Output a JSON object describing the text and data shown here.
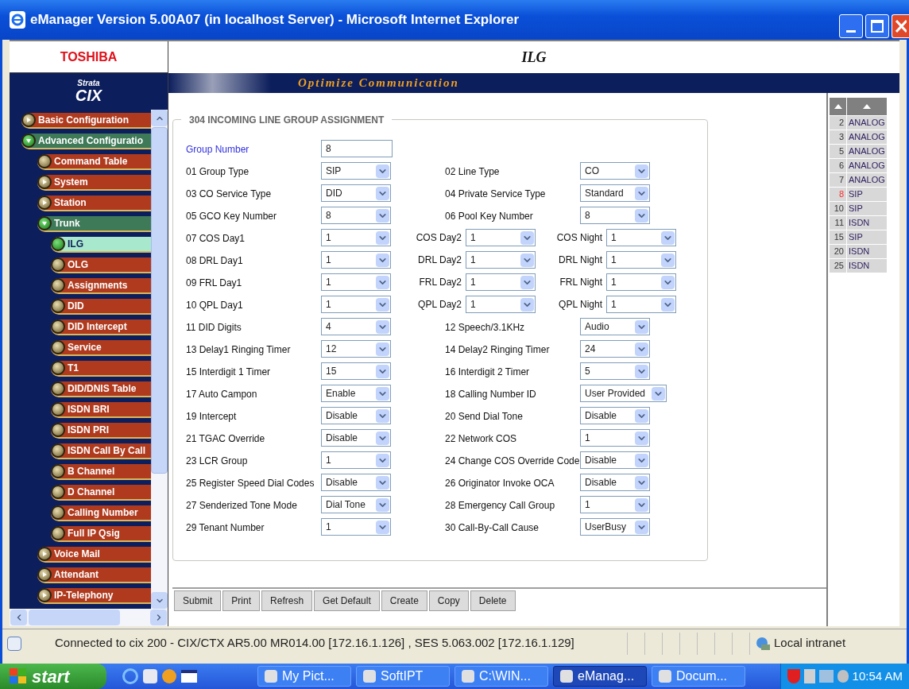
{
  "window": {
    "title": "eManager Version 5.00A07 (in localhost Server) - Microsoft Internet Explorer"
  },
  "header": {
    "brand": "TOSHIBA",
    "page_title": "ILG",
    "logo_top": "Strata",
    "logo_main": "CIX",
    "slogan": "Optimize Communication"
  },
  "nav": [
    {
      "label": "Basic Configuration",
      "expanded": false,
      "selected": false
    },
    {
      "label": "Advanced Configuratio",
      "expanded": true,
      "selected": false,
      "children": [
        {
          "label": "Command Table",
          "selected": false
        },
        {
          "label": "System",
          "expanded": false,
          "selected": false
        },
        {
          "label": "Station",
          "expanded": false,
          "selected": false
        },
        {
          "label": "Trunk",
          "expanded": true,
          "selected": false,
          "children": [
            {
              "label": "ILG",
              "selected": true
            },
            {
              "label": "OLG",
              "selected": false
            },
            {
              "label": "Assignments",
              "selected": false
            },
            {
              "label": "DID",
              "selected": false
            },
            {
              "label": "DID Intercept",
              "selected": false
            },
            {
              "label": "Service",
              "selected": false
            },
            {
              "label": "T1",
              "selected": false
            },
            {
              "label": "DID/DNIS Table",
              "selected": false
            },
            {
              "label": "ISDN BRI",
              "selected": false
            },
            {
              "label": "ISDN PRI",
              "selected": false
            },
            {
              "label": "ISDN Call By Call",
              "selected": false
            },
            {
              "label": "B Channel",
              "selected": false
            },
            {
              "label": "D Channel",
              "selected": false
            },
            {
              "label": "Calling Number",
              "selected": false
            },
            {
              "label": "Full IP Qsig",
              "selected": false
            }
          ]
        },
        {
          "label": "Voice Mail",
          "expanded": false,
          "selected": false
        },
        {
          "label": "Attendant",
          "expanded": false,
          "selected": false
        },
        {
          "label": "IP-Telephony",
          "expanded": false,
          "selected": false
        }
      ]
    }
  ],
  "form": {
    "title": "304 INCOMING LINE GROUP ASSIGNMENT",
    "group_number": {
      "label": "Group Number",
      "value": "8"
    },
    "rows": [
      [
        {
          "label": "01 Group Type",
          "value": "SIP"
        },
        {
          "label": "02 Line Type",
          "value": "CO"
        }
      ],
      [
        {
          "label": "03 CO Service Type",
          "value": "DID"
        },
        {
          "label": "04 Private Service Type",
          "value": "Standard"
        }
      ],
      [
        {
          "label": "05 GCO Key Number",
          "value": "8"
        },
        {
          "label": "06 Pool Key Number",
          "value": "8"
        }
      ],
      [
        {
          "label": "07 COS Day1",
          "value": "1"
        },
        {
          "label": "COS Day2",
          "value": "1"
        },
        {
          "label": "COS Night",
          "value": "1"
        }
      ],
      [
        {
          "label": "08 DRL Day1",
          "value": "1"
        },
        {
          "label": "DRL Day2",
          "value": "1"
        },
        {
          "label": "DRL Night",
          "value": "1"
        }
      ],
      [
        {
          "label": "09 FRL Day1",
          "value": "1"
        },
        {
          "label": "FRL Day2",
          "value": "1"
        },
        {
          "label": "FRL Night",
          "value": "1"
        }
      ],
      [
        {
          "label": "10 QPL Day1",
          "value": "1"
        },
        {
          "label": "QPL Day2",
          "value": "1"
        },
        {
          "label": "QPL Night",
          "value": "1"
        }
      ],
      [
        {
          "label": "11 DID Digits",
          "value": "4"
        },
        {
          "label": "12 Speech/3.1KHz",
          "value": "Audio"
        }
      ],
      [
        {
          "label": "13 Delay1 Ringing Timer",
          "value": "12"
        },
        {
          "label": "14 Delay2 Ringing Timer",
          "value": "24"
        }
      ],
      [
        {
          "label": "15 Interdigit 1 Timer",
          "value": "15"
        },
        {
          "label": "16 Interdigit 2 Timer",
          "value": "5"
        }
      ],
      [
        {
          "label": "17 Auto Campon",
          "value": "Enable"
        },
        {
          "label": "18 Calling Number ID",
          "value": "User Provided"
        }
      ],
      [
        {
          "label": "19 Intercept",
          "value": "Disable"
        },
        {
          "label": "20 Send Dial Tone",
          "value": "Disable"
        }
      ],
      [
        {
          "label": "21 TGAC Override",
          "value": "Disable"
        },
        {
          "label": "22 Network COS",
          "value": "1"
        }
      ],
      [
        {
          "label": "23 LCR Group",
          "value": "1"
        },
        {
          "label": "24 Change COS Override Code",
          "value": "Disable"
        }
      ],
      [
        {
          "label": "25 Register Speed Dial Codes",
          "value": "Disable"
        },
        {
          "label": "26 Originator Invoke OCA",
          "value": "Disable"
        }
      ],
      [
        {
          "label": "27 Senderized Tone Mode",
          "value": "Dial Tone"
        },
        {
          "label": "28 Emergency Call Group",
          "value": "1"
        }
      ],
      [
        {
          "label": "29 Tenant Number",
          "value": "1"
        },
        {
          "label": "30 Call-By-Call Cause",
          "value": "UserBusy"
        }
      ]
    ]
  },
  "buttons": [
    "Submit",
    "Print",
    "Refresh",
    "Get Default",
    "Create",
    "Copy",
    "Delete"
  ],
  "group_list": [
    {
      "number": "2",
      "type": "ANALOG",
      "selected": false
    },
    {
      "number": "3",
      "type": "ANALOG",
      "selected": false
    },
    {
      "number": "5",
      "type": "ANALOG",
      "selected": false
    },
    {
      "number": "6",
      "type": "ANALOG",
      "selected": false
    },
    {
      "number": "7",
      "type": "ANALOG",
      "selected": false
    },
    {
      "number": "8",
      "type": "SIP",
      "selected": true
    },
    {
      "number": "10",
      "type": "SIP",
      "selected": false
    },
    {
      "number": "11",
      "type": "ISDN",
      "selected": false
    },
    {
      "number": "15",
      "type": "SIP",
      "selected": false
    },
    {
      "number": "20",
      "type": "ISDN",
      "selected": false
    },
    {
      "number": "25",
      "type": "ISDN",
      "selected": false
    }
  ],
  "status_bar": {
    "text": "Connected to cix 200 - CIX/CTX AR5.00 MR014.00 [172.16.1.126] , SES 5.063.002 [172.16.1.129]",
    "zone": "Local intranet"
  },
  "taskbar": {
    "start": "start",
    "tasks": [
      {
        "label": "My Pict...",
        "selected": false
      },
      {
        "label": "SoftIPT",
        "selected": false
      },
      {
        "label": "C:\\WIN...",
        "selected": false
      },
      {
        "label": "eManag...",
        "selected": true
      },
      {
        "label": "Docum...",
        "selected": false
      }
    ],
    "clock": "10:54 AM"
  }
}
